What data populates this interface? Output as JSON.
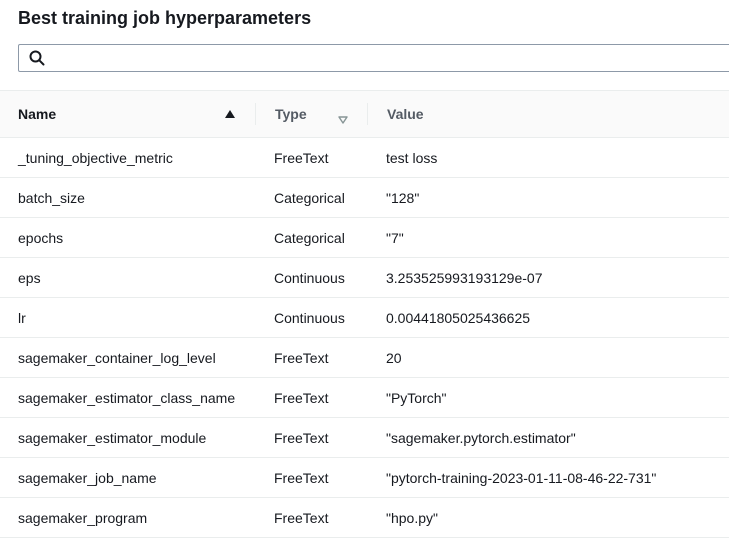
{
  "title": "Best training job hyperparameters",
  "search": {
    "placeholder": "",
    "value": ""
  },
  "columns": {
    "name": "Name",
    "type": "Type",
    "value": "Value"
  },
  "icons": {
    "search": "search-icon",
    "sort_asc": "sort-ascending-icon",
    "sort_none": "sort-descending-outline-icon"
  },
  "rows": [
    {
      "name": "_tuning_objective_metric",
      "type": "FreeText",
      "value": "test loss"
    },
    {
      "name": "batch_size",
      "type": "Categorical",
      "value": "\"128\""
    },
    {
      "name": "epochs",
      "type": "Categorical",
      "value": "\"7\""
    },
    {
      "name": "eps",
      "type": "Continuous",
      "value": "3.253525993193129e-07"
    },
    {
      "name": "lr",
      "type": "Continuous",
      "value": "0.00441805025436625"
    },
    {
      "name": "sagemaker_container_log_level",
      "type": "FreeText",
      "value": "20"
    },
    {
      "name": "sagemaker_estimator_class_name",
      "type": "FreeText",
      "value": "\"PyTorch\""
    },
    {
      "name": "sagemaker_estimator_module",
      "type": "FreeText",
      "value": "\"sagemaker.pytorch.estimator\""
    },
    {
      "name": "sagemaker_job_name",
      "type": "FreeText",
      "value": "\"pytorch-training-2023-01-11-08-46-22-731\""
    },
    {
      "name": "sagemaker_program",
      "type": "FreeText",
      "value": "\"hpo.py\""
    }
  ]
}
